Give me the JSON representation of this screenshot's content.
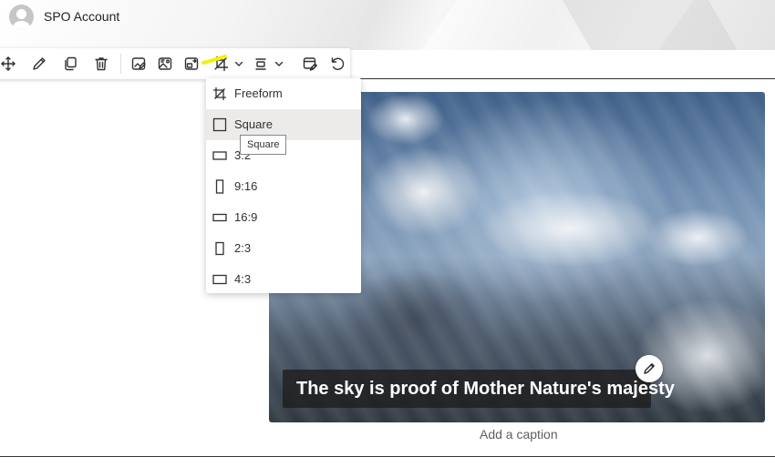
{
  "header": {
    "account_name": "SPO Account"
  },
  "toolbar": {
    "items": [
      {
        "id": "move",
        "icon": "move-icon"
      },
      {
        "id": "edit",
        "icon": "pencil-icon"
      },
      {
        "id": "duplicate",
        "icon": "duplicate-icon"
      },
      {
        "id": "delete",
        "icon": "trash-icon"
      },
      {
        "id": "image-edit",
        "icon": "image-edit-icon"
      },
      {
        "id": "alt-text",
        "icon": "image-alt-icon"
      },
      {
        "id": "replace",
        "icon": "image-replace-icon"
      },
      {
        "id": "crop",
        "icon": "crop-icon"
      },
      {
        "id": "align",
        "icon": "align-icon"
      },
      {
        "id": "caption",
        "icon": "caption-edit-icon"
      },
      {
        "id": "reset",
        "icon": "undo-icon"
      }
    ],
    "highlight_color": "#f4f20a"
  },
  "crop_menu": {
    "items": [
      {
        "label": "Freeform",
        "icon": "freeform-crop-icon"
      },
      {
        "label": "Square",
        "icon": "square-icon",
        "selected": true
      },
      {
        "label": "3:2",
        "icon": "landscape-rect-icon"
      },
      {
        "label": "9:16",
        "icon": "portrait-rect-icon"
      },
      {
        "label": "16:9",
        "icon": "landscape-rect-icon"
      },
      {
        "label": "2:3",
        "icon": "portrait-rect-icon"
      },
      {
        "label": "4:3",
        "icon": "landscape-rect-icon"
      }
    ],
    "tooltip": "Square"
  },
  "image": {
    "overlay_text": "The sky is proof of Mother Nature's majesty",
    "caption_placeholder": "Add a caption"
  }
}
